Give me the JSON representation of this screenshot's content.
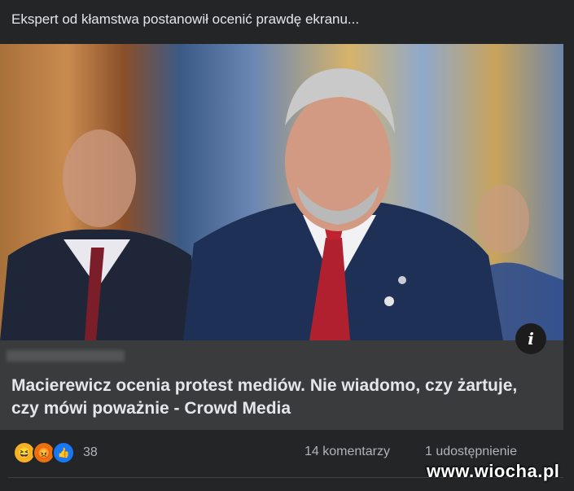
{
  "post": {
    "text": "Ekspert od kłamstwa postanowił ocenić prawdę ekranu..."
  },
  "link_preview": {
    "title": "Macierewicz ocenia protest mediów. Nie wiadomo, czy żartuje, czy mówi poważnie - Crowd Media",
    "info_symbol": "i"
  },
  "reactions": {
    "icons": [
      "haha-icon",
      "angry-icon",
      "like-icon"
    ],
    "count": "38"
  },
  "stats": {
    "comments": "14 komentarzy",
    "shares": "1 udostępnienie"
  },
  "watermark": "www.wiocha.pl",
  "colors": {
    "background": "#242526",
    "card": "#3a3b3c",
    "text": "#e4e6eb",
    "muted": "#b0b3b8",
    "like_blue": "#1877f2"
  }
}
